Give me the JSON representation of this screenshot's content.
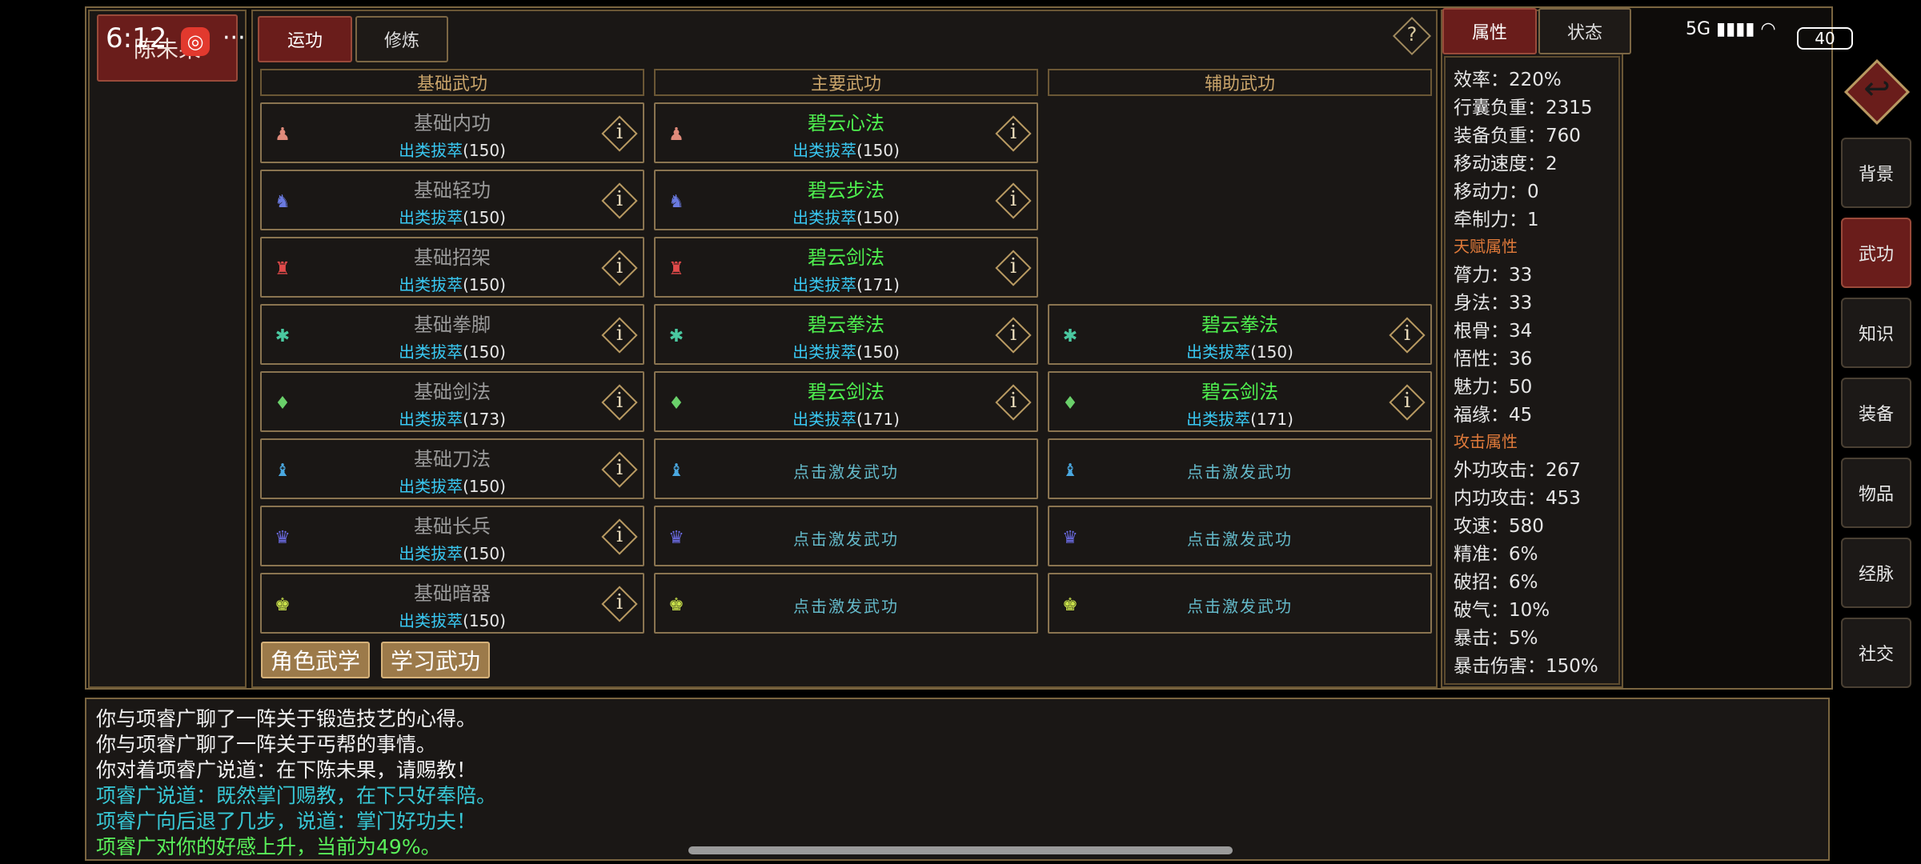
{
  "status": {
    "time": "6:12",
    "app_badge": "◎",
    "more": "···",
    "network": "5G",
    "battery": "40"
  },
  "player": {
    "name": "陈未果"
  },
  "tabs": {
    "left": [
      {
        "label": "运功",
        "active": true
      },
      {
        "label": "修炼",
        "active": false
      }
    ],
    "help": "?"
  },
  "columns": {
    "basic": "基础武功",
    "main": "主要武功",
    "aux": "辅助武功"
  },
  "level_label": "出类拔萃",
  "empty_label": "点击激发武功",
  "info_glyph": "i",
  "basic_slots": [
    {
      "name": "基础内功",
      "level": "(150)",
      "icon": "fist-icon",
      "glyph": "♟",
      "color": "#e08a7a"
    },
    {
      "name": "基础轻功",
      "level": "(150)",
      "icon": "runner-icon",
      "glyph": "♞",
      "color": "#6a7ae0"
    },
    {
      "name": "基础招架",
      "level": "(150)",
      "icon": "shield-icon",
      "glyph": "♜",
      "color": "#e04a4a"
    },
    {
      "name": "基础拳脚",
      "level": "(150)",
      "icon": "kick-icon",
      "glyph": "✱",
      "color": "#4ac8a0"
    },
    {
      "name": "基础剑法",
      "level": "(173)",
      "icon": "sword-icon",
      "glyph": "♦",
      "color": "#6ad06a"
    },
    {
      "name": "基础刀法",
      "level": "(150)",
      "icon": "blade-icon",
      "glyph": "♝",
      "color": "#4aa8e0"
    },
    {
      "name": "基础长兵",
      "level": "(150)",
      "icon": "spear-icon",
      "glyph": "♛",
      "color": "#6a6ae0"
    },
    {
      "name": "基础暗器",
      "level": "(150)",
      "icon": "dart-icon",
      "glyph": "♚",
      "color": "#c8e04a"
    }
  ],
  "main_slots": [
    {
      "name": "碧云心法",
      "level": "(150)",
      "filled": true
    },
    {
      "name": "碧云步法",
      "level": "(150)",
      "filled": true
    },
    {
      "name": "碧云剑法",
      "level": "(171)",
      "filled": true
    },
    {
      "name": "碧云拳法",
      "level": "(150)",
      "filled": true
    },
    {
      "name": "碧云剑法",
      "level": "(171)",
      "filled": true
    },
    {
      "filled": false
    },
    {
      "filled": false
    },
    {
      "filled": false
    }
  ],
  "aux_slots": [
    {
      "name": "碧云拳法",
      "level": "(150)",
      "filled": true
    },
    {
      "name": "碧云剑法",
      "level": "(171)",
      "filled": true
    },
    {
      "filled": false
    },
    {
      "filled": false
    },
    {
      "filled": false
    }
  ],
  "buttons": {
    "role_martial": "角色武学",
    "learn_martial": "学习武功"
  },
  "right_tabs": [
    {
      "label": "属性",
      "active": true
    },
    {
      "label": "状态",
      "active": false
    }
  ],
  "attributes": [
    {
      "label": "效率：",
      "value": "220%"
    },
    {
      "label": "行囊负重：",
      "value": "2315"
    },
    {
      "label": "装备负重：",
      "value": "760"
    },
    {
      "label": "移动速度：",
      "value": "2"
    },
    {
      "label": "移动力：",
      "value": "0"
    },
    {
      "label": "牵制力：",
      "value": "1"
    }
  ],
  "talent_title": "天赋属性",
  "talents": [
    {
      "label": "膂力：",
      "value": "33"
    },
    {
      "label": "身法：",
      "value": "33"
    },
    {
      "label": "根骨：",
      "value": "34"
    },
    {
      "label": "悟性：",
      "value": "36"
    },
    {
      "label": "魅力：",
      "value": "50"
    },
    {
      "label": "福缘：",
      "value": "45"
    }
  ],
  "attack_title": "攻击属性",
  "attacks": [
    {
      "label": "外功攻击：",
      "value": "267"
    },
    {
      "label": "内功攻击：",
      "value": "453"
    },
    {
      "label": "攻速：",
      "value": "580"
    },
    {
      "label": "精准：",
      "value": "6%"
    },
    {
      "label": "破招：",
      "value": "6%"
    },
    {
      "label": "破气：",
      "value": "10%"
    },
    {
      "label": "暴击：",
      "value": "5%"
    },
    {
      "label": "暴击伤害：",
      "value": "150%"
    }
  ],
  "side_nav": [
    {
      "label": "背景",
      "active": false
    },
    {
      "label": "武功",
      "active": true
    },
    {
      "label": "知识",
      "active": false
    },
    {
      "label": "装备",
      "active": false
    },
    {
      "label": "物品",
      "active": false
    },
    {
      "label": "经脉",
      "active": false
    },
    {
      "label": "社交",
      "active": false
    }
  ],
  "back_glyph": "↩",
  "log": [
    {
      "text": "你与项睿广聊了一阵关于锻造技艺的心得。",
      "style": "white"
    },
    {
      "text": "你与项睿广聊了一阵关于丐帮的事情。",
      "style": "white"
    },
    {
      "text": "你对着项睿广说道：在下陈未果，请赐教！",
      "style": "white"
    },
    {
      "text": "项睿广说道：既然掌门赐教，在下只好奉陪。",
      "style": "cyan"
    },
    {
      "text": "项睿广向后退了几步，说道：掌门好功夫！",
      "style": "cyan"
    },
    {
      "text": "项睿广对你的好感上升，当前为49%。",
      "style": "green"
    }
  ]
}
